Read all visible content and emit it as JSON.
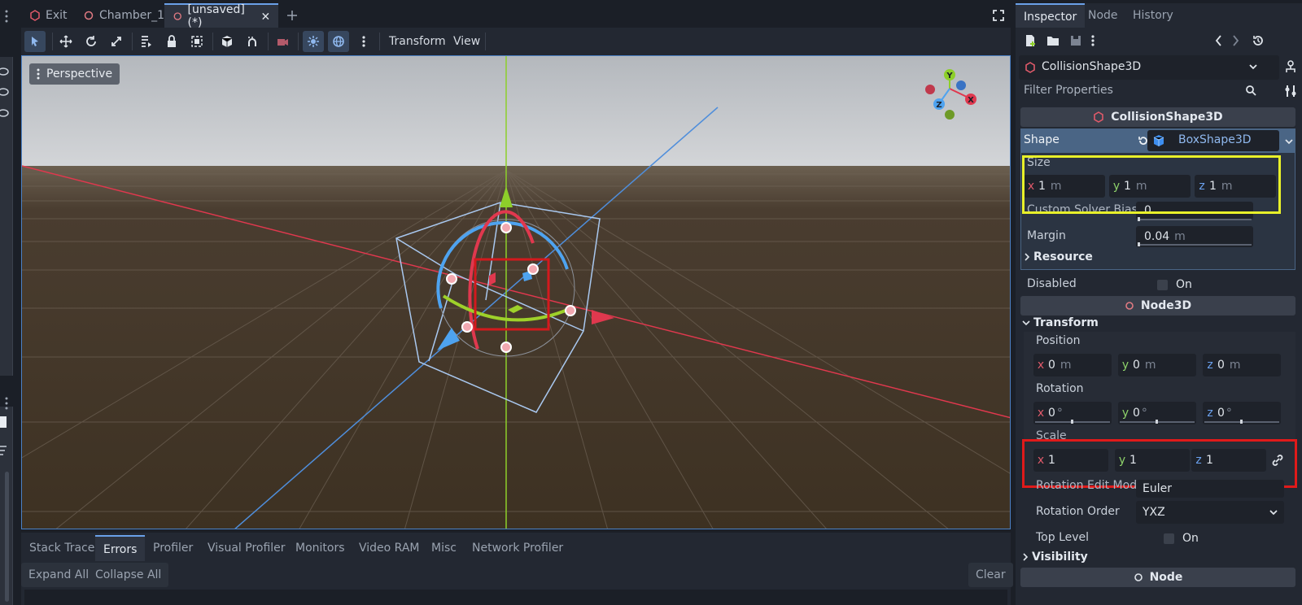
{
  "scene_tabs": [
    {
      "label": "Exit",
      "icon": "scene-cube-icon"
    },
    {
      "label": "Chamber_1",
      "icon": "node-circle-icon"
    },
    {
      "label": "[unsaved](*)",
      "icon": "node-circle-icon",
      "active": true
    }
  ],
  "toolbar": {
    "transform_menu": "Transform",
    "view_menu": "View"
  },
  "viewport": {
    "perspective_label": "Perspective",
    "gizmo": {
      "x": "X",
      "y": "Y",
      "z": "Z"
    }
  },
  "bottom_panel": {
    "tabs": [
      "Stack Trace",
      "Errors",
      "Profiler",
      "Visual Profiler",
      "Monitors",
      "Video RAM",
      "Misc",
      "Network Profiler"
    ],
    "active_tab": "Errors",
    "expand_all": "Expand All",
    "collapse_all": "Collapse All",
    "clear": "Clear"
  },
  "inspector": {
    "tabs": [
      "Inspector",
      "Node",
      "History"
    ],
    "node_selector": "CollisionShape3D",
    "filter_placeholder": "Filter Properties",
    "collision_section": "CollisionShape3D",
    "shape_label": "Shape",
    "shape_value": "BoxShape3D",
    "size_label": "Size",
    "size": {
      "x": "1",
      "y": "1",
      "z": "1",
      "unit": "m"
    },
    "custom_solver_bias_label": "Custom Solver Bias",
    "custom_solver_bias_value": "0",
    "margin_label": "Margin",
    "margin_value": "0.04",
    "margin_unit": "m",
    "resource_label": "Resource",
    "disabled_label": "Disabled",
    "disabled_value": "On",
    "node3d_section": "Node3D",
    "transform_label": "Transform",
    "position_label": "Position",
    "position": {
      "x": "0",
      "y": "0",
      "z": "0",
      "unit": "m"
    },
    "rotation_label": "Rotation",
    "rotation": {
      "x": "0",
      "y": "0",
      "z": "0",
      "unit": "°"
    },
    "scale_label": "Scale",
    "scale": {
      "x": "1",
      "y": "1",
      "z": "1"
    },
    "rotation_edit_mode_label": "Rotation Edit Mode",
    "rotation_edit_mode_value": "Euler",
    "rotation_order_label": "Rotation Order",
    "rotation_order_value": "YXZ",
    "top_level_label": "Top Level",
    "top_level_value": "On",
    "visibility_label": "Visibility",
    "node_section": "Node",
    "axis_letters": {
      "x": "x",
      "y": "y",
      "z": "z"
    }
  },
  "colors": {
    "accent": "#6aa0e8",
    "axis_x": "#e05a6a",
    "axis_y": "#8dd16a",
    "axis_z": "#6ba2f0",
    "highlight_yellow": "#e8f02a",
    "highlight_red": "#e01a1a"
  }
}
